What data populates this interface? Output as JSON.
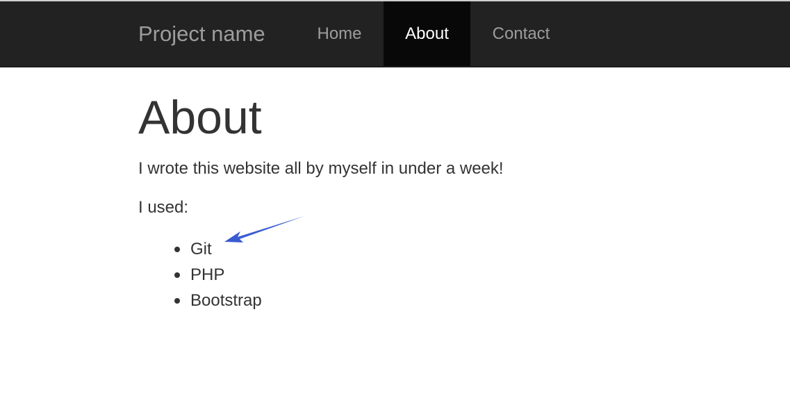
{
  "navbar": {
    "brand": "Project name",
    "items": [
      {
        "label": "Home",
        "active": false
      },
      {
        "label": "About",
        "active": true
      },
      {
        "label": "Contact",
        "active": false
      }
    ]
  },
  "main": {
    "title": "About",
    "intro": "I wrote this website all by myself in under a week!",
    "used_label": "I used:",
    "tools": [
      "Git",
      "PHP",
      "Bootstrap"
    ]
  },
  "colors": {
    "navbar_bg": "#222222",
    "active_bg": "#080808",
    "text": "#333333",
    "annotation_arrow": "#3a5bd1"
  },
  "icons": {
    "annotation": "annotation-arrow-icon"
  }
}
